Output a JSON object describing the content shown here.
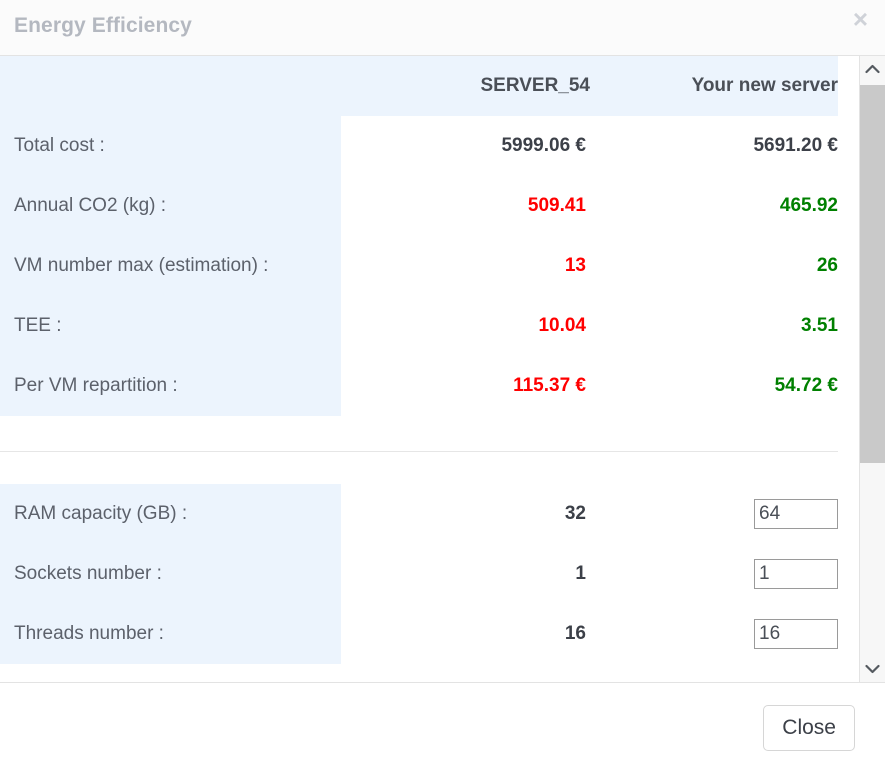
{
  "modal": {
    "title": "Energy Efficiency",
    "close_icon": "close-icon",
    "close_icon_glyph": "×"
  },
  "comparison": {
    "column_headers": {
      "label": "",
      "current": "SERVER_54",
      "proposed": "Your new server"
    },
    "rows": [
      {
        "label": "Total cost :",
        "current": "5999.06 €",
        "proposed": "5691.20 €",
        "current_state": "neutral",
        "proposed_state": "neutral"
      },
      {
        "label": "Annual CO2 (kg) :",
        "current": "509.41",
        "proposed": "465.92",
        "current_state": "negative",
        "proposed_state": "positive"
      },
      {
        "label": "VM number max (estimation) :",
        "current": "13",
        "proposed": "26",
        "current_state": "negative",
        "proposed_state": "positive"
      },
      {
        "label": "TEE :",
        "current": "10.04",
        "proposed": "3.51",
        "current_state": "negative",
        "proposed_state": "positive"
      },
      {
        "label": "Per VM repartition :",
        "current": "115.37 €",
        "proposed": "54.72 €",
        "current_state": "negative",
        "proposed_state": "positive"
      }
    ]
  },
  "specs": {
    "rows": [
      {
        "label": "RAM capacity (GB) :",
        "current": "32",
        "input_value": "64"
      },
      {
        "label": "Sockets number :",
        "current": "1",
        "input_value": "1"
      },
      {
        "label": "Threads number :",
        "current": "16",
        "input_value": "16"
      }
    ]
  },
  "scrollbar": {
    "up_icon": "chevron-up-icon",
    "down_icon": "chevron-down-icon"
  },
  "footer": {
    "close_label": "Close"
  },
  "colors": {
    "negative": "#ff0000",
    "positive": "#008000",
    "table_highlight": "#ecf4fd",
    "title_text": "#b4b8c0"
  }
}
